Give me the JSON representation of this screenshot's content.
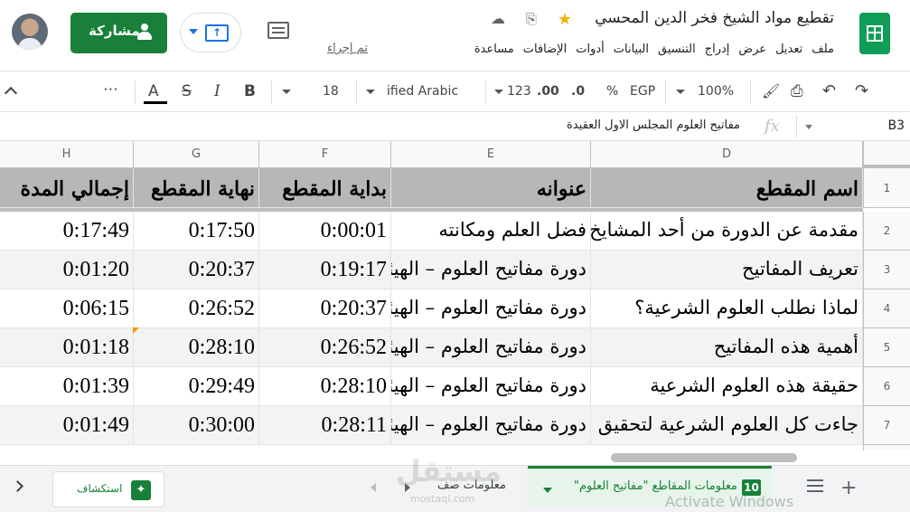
{
  "title_bar": {
    "doc_title": "تقطيع مواد الشيخ فخر الدين المحسي",
    "star_icon": "star-icon",
    "move_icon": "folder-move-icon",
    "cloud_icon": "cloud-status-icon",
    "star_color": "#f4b400"
  },
  "menu": [
    "ملف",
    "تعديل",
    "عرض",
    "إدراج",
    "التنسيق",
    "البيانات",
    "أدوات",
    "الإضافات",
    "مساعدة"
  ],
  "last_edit": "تم إجراء",
  "share_button": {
    "label": "مشاركة",
    "color": "#188038"
  },
  "toolbar": {
    "zoom": "100%",
    "currency": "EGP",
    "percent": "%",
    "decimal_decrease": ".0",
    "decimal_increase": ".00",
    "number_format": "123",
    "font": "ified Arabic",
    "font_size": "18",
    "bold": "B",
    "italic": "I",
    "strike": "S",
    "text_color": "A",
    "more": "⋯"
  },
  "formula_bar": {
    "cell_ref": "B3",
    "fx": "fx",
    "content": "مفاتيح العلوم المجلس الاول العقيدة"
  },
  "grid": {
    "columns": [
      "H",
      "G",
      "F",
      "E",
      "D"
    ],
    "row_numbers": [
      "1",
      "2",
      "3",
      "4",
      "5",
      "6",
      "7"
    ],
    "header_row": {
      "H": "إجمالي المدة",
      "G": "نهاية المقطع",
      "F": "بداية المقطع",
      "E": "عنوانه",
      "D": "اسم المقطع"
    },
    "rows": [
      {
        "D": "مقدمة عن الدورة من أحد المشايخ",
        "E": "فضل العلم ومكانته",
        "F": "0:00:01",
        "G": "0:17:50",
        "H": "0:17:49"
      },
      {
        "D": "تعريف المفاتيح",
        "E": "دورة مفاتيح العلوم – الهيئة",
        "F": "0:19:17",
        "G": "0:20:37",
        "H": "0:01:20"
      },
      {
        "D": "لماذا نطلب العلوم الشرعية؟",
        "E": "دورة مفاتيح العلوم – الهيئة",
        "F": "0:20:37",
        "G": "0:26:52",
        "H": "0:06:15"
      },
      {
        "D": "أهمية هذه المفاتيح",
        "E": "دورة مفاتيح العلوم – الهيئة",
        "F": "0:26:52",
        "G": "0:28:10",
        "H": "0:01:18"
      },
      {
        "D": "حقيقة هذه العلوم الشرعية",
        "E": "دورة مفاتيح العلوم – الهيئة",
        "F": "0:28:10",
        "G": "0:29:49",
        "H": "0:01:39"
      },
      {
        "D": "جاءت كل العلوم الشرعية لتحقيق",
        "E": "دورة مفاتيح العلوم – الهيئة",
        "F": "0:28:11",
        "G": "0:30:00",
        "H": "0:01:49"
      }
    ],
    "header_fill": "#b7b7b7",
    "alt_fill": "#f3f3f3"
  },
  "sheet_tabs": {
    "active": {
      "number": "10",
      "label": "معلومات المقاطع \"مفاتيح العلوم\""
    },
    "second": {
      "label": "معلومات صف"
    },
    "explore": "استكشاف",
    "add": "+"
  },
  "watermarks": {
    "activate": "Activate Windows",
    "logo": "مستقل",
    "logo_sub": "mostaql.com"
  }
}
